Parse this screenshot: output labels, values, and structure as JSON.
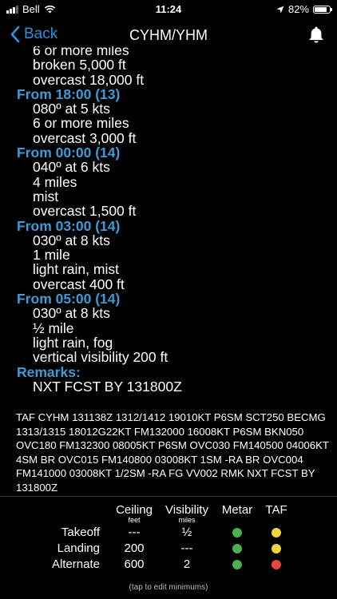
{
  "status_bar": {
    "carrier": "Bell",
    "time": "11:24",
    "battery": "82%",
    "battery_level": 0.82
  },
  "nav": {
    "back_label": "Back",
    "title": "CYHM/YHM"
  },
  "forecast": [
    {
      "type": "line",
      "text": "6 or more miles"
    },
    {
      "type": "line",
      "text": "broken 5,000 ft"
    },
    {
      "type": "line",
      "text": "overcast 18,000 ft"
    },
    {
      "type": "head",
      "text": "From 18:00 (13)"
    },
    {
      "type": "line",
      "text": "080º at 5 kts"
    },
    {
      "type": "line",
      "text": "6 or more miles"
    },
    {
      "type": "line",
      "text": "overcast 3,000 ft"
    },
    {
      "type": "head",
      "text": "From 00:00 (14)"
    },
    {
      "type": "line",
      "text": "040º at 6 kts"
    },
    {
      "type": "line",
      "text": "4 miles"
    },
    {
      "type": "line",
      "text": "mist"
    },
    {
      "type": "line",
      "text": "overcast 1,500 ft"
    },
    {
      "type": "head",
      "text": "From 03:00 (14)"
    },
    {
      "type": "line",
      "text": "030º at 8 kts"
    },
    {
      "type": "line",
      "text": "1 mile"
    },
    {
      "type": "line",
      "text": "light rain, mist"
    },
    {
      "type": "line",
      "text": "overcast 400 ft"
    },
    {
      "type": "head",
      "text": "From 05:00 (14)"
    },
    {
      "type": "line",
      "text": "030º at 8 kts"
    },
    {
      "type": "line",
      "text": "½ mile"
    },
    {
      "type": "line",
      "text": "light rain, fog"
    },
    {
      "type": "line",
      "text": "vertical visibility 200 ft"
    },
    {
      "type": "head",
      "text": "Remarks:"
    },
    {
      "type": "line",
      "text": "NXT FCST BY 131800Z"
    }
  ],
  "raw_taf": "TAF CYHM 131138Z 1312/1412 19010KT P6SM SCT250 BECMG 1313/1315 18012G22KT FM132000 16008KT P6SM BKN050 OVC180 FM132300 08005KT P6SM OVC030 FM140500 04006KT 4SM BR OVC015 FM140800 03008KT 1SM -RA BR OVC004 FM141000 03008KT 1/2SM -RA FG VV002 RMK NXT FCST BY 131800Z",
  "minimums": {
    "headers": {
      "ceiling": "Ceiling",
      "ceiling_unit": "feet",
      "visibility": "Visibility",
      "visibility_unit": "miles",
      "metar": "Metar",
      "taf": "TAF"
    },
    "rows": [
      {
        "label": "Takeoff",
        "ceiling": "---",
        "visibility": "½",
        "metar": "#4caf50",
        "taf": "#f2d33c"
      },
      {
        "label": "Landing",
        "ceiling": "200",
        "visibility": "---",
        "metar": "#4caf50",
        "taf": "#f2d33c"
      },
      {
        "label": "Alternate",
        "ceiling": "600",
        "visibility": "2",
        "metar": "#4caf50",
        "taf": "#e5473c"
      }
    ],
    "hint": "(tap to edit minimums)"
  },
  "colors": {
    "accent": "#2f8fd8",
    "heading": "#3d9bd6",
    "background": "#000000"
  }
}
